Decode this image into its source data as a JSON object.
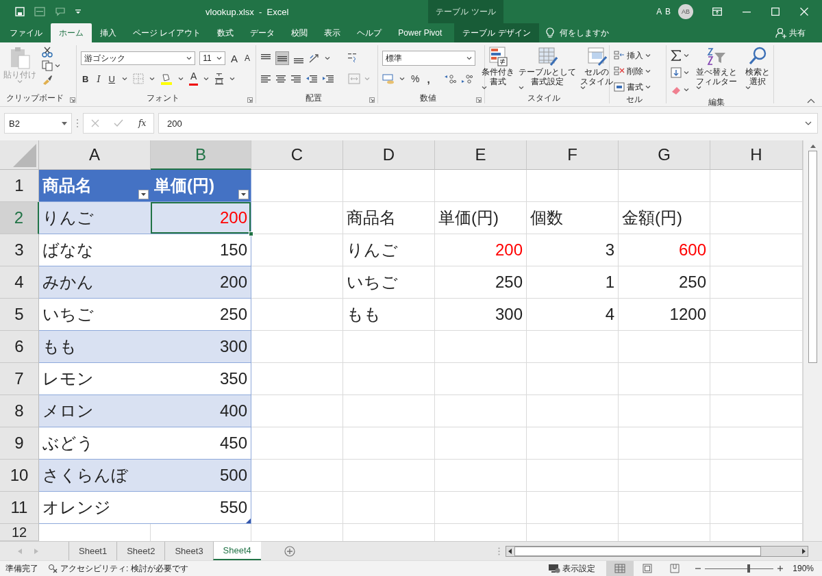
{
  "window": {
    "title": "vlookup.xlsx  -  Excel",
    "context_title": "テーブル ツール",
    "user": "A B",
    "avatar": "AB"
  },
  "tabs": [
    {
      "label": "ファイル",
      "kind": "file",
      "selected": false
    },
    {
      "label": "ホーム",
      "kind": "normal",
      "selected": true
    },
    {
      "label": "挿入",
      "kind": "normal",
      "selected": false
    },
    {
      "label": "ページ レイアウト",
      "kind": "normal",
      "selected": false
    },
    {
      "label": "数式",
      "kind": "normal",
      "selected": false
    },
    {
      "label": "データ",
      "kind": "normal",
      "selected": false
    },
    {
      "label": "校閲",
      "kind": "normal",
      "selected": false
    },
    {
      "label": "表示",
      "kind": "normal",
      "selected": false
    },
    {
      "label": "ヘルプ",
      "kind": "normal",
      "selected": false
    },
    {
      "label": "Power Pivot",
      "kind": "normal",
      "selected": false
    },
    {
      "label": "テーブル デザイン",
      "kind": "contextual",
      "selected": false
    }
  ],
  "tell_me": "何をしますか",
  "share": "共有",
  "ribbon": {
    "clipboard": {
      "label": "クリップボード",
      "paste": "貼り付け"
    },
    "font": {
      "label": "フォント",
      "font_name": "游ゴシック",
      "font_size": "11",
      "grow": "A",
      "shrink": "A",
      "bold": "B",
      "italic": "I",
      "underline": "U",
      "font_color": "A"
    },
    "alignment": {
      "label": "配置"
    },
    "number": {
      "label": "数値",
      "format": "標準",
      "percent": "%",
      "comma": ","
    },
    "styles": {
      "label": "スタイル",
      "buttons": [
        {
          "lines": [
            "条件付き",
            "書式"
          ]
        },
        {
          "lines": [
            "テーブルとして",
            "書式設定"
          ]
        },
        {
          "lines": [
            "セルの",
            "スタイル"
          ]
        }
      ]
    },
    "cells": {
      "label": "セル",
      "buttons": [
        "挿入",
        "削除",
        "書式"
      ]
    },
    "editing": {
      "label": "編集",
      "sort": [
        "並べ替えと",
        "フィルター"
      ],
      "find": [
        "検索と",
        "選択"
      ]
    }
  },
  "formula_bar": {
    "name_box": "B2",
    "fx": "fx",
    "formula": "200"
  },
  "grid": {
    "columns": [
      {
        "label": "A",
        "selected": false
      },
      {
        "label": "B",
        "selected": true
      },
      {
        "label": "C",
        "selected": false
      },
      {
        "label": "D",
        "selected": false
      },
      {
        "label": "E",
        "selected": false
      },
      {
        "label": "F",
        "selected": false
      },
      {
        "label": "G",
        "selected": false
      },
      {
        "label": "H",
        "selected": false
      }
    ],
    "rows": [
      {
        "number": "1",
        "selected": false,
        "cells": [
          {
            "kind": "header",
            "text": "商品名",
            "selected": false
          },
          {
            "kind": "header",
            "text": "単価(円)",
            "selected": false
          },
          {
            "kind": "empty",
            "selected": false
          },
          {
            "kind": "empty",
            "selected": false
          },
          {
            "kind": "empty",
            "selected": false
          },
          {
            "kind": "empty",
            "selected": false
          },
          {
            "kind": "empty",
            "selected": false
          },
          {
            "kind": "empty",
            "selected": false
          }
        ]
      },
      {
        "number": "2",
        "selected": true,
        "cells": [
          {
            "kind": "band_text",
            "text": "りんご",
            "selected": false
          },
          {
            "kind": "band_number",
            "text": "200",
            "color": "#ff0000",
            "selected": true
          },
          {
            "kind": "empty",
            "selected": false
          },
          {
            "kind": "plain_text",
            "text": "商品名",
            "selected": false
          },
          {
            "kind": "plain_text",
            "text": "単価(円)",
            "selected": false
          },
          {
            "kind": "plain_text",
            "text": "個数",
            "selected": false
          },
          {
            "kind": "plain_text",
            "text": "金額(円)",
            "selected": false
          },
          {
            "kind": "empty",
            "selected": false
          }
        ]
      },
      {
        "number": "3",
        "selected": false,
        "cells": [
          {
            "kind": "row_text",
            "text": "ばなな",
            "selected": false
          },
          {
            "kind": "row_number",
            "text": "150",
            "selected": false
          },
          {
            "kind": "empty",
            "selected": false
          },
          {
            "kind": "plain_text",
            "text": "りんご",
            "selected": false
          },
          {
            "kind": "plain_number",
            "text": "200",
            "color": "#ff0000",
            "selected": false
          },
          {
            "kind": "plain_number",
            "text": "3",
            "selected": false
          },
          {
            "kind": "plain_number",
            "text": "600",
            "color": "#ff0000",
            "selected": false
          },
          {
            "kind": "empty",
            "selected": false
          }
        ]
      },
      {
        "number": "4",
        "selected": false,
        "cells": [
          {
            "kind": "band_text",
            "text": "みかん",
            "selected": false
          },
          {
            "kind": "band_number",
            "text": "200",
            "selected": false
          },
          {
            "kind": "empty",
            "selected": false
          },
          {
            "kind": "plain_text",
            "text": "いちご",
            "selected": false
          },
          {
            "kind": "plain_number",
            "text": "250",
            "selected": false
          },
          {
            "kind": "plain_number",
            "text": "1",
            "selected": false
          },
          {
            "kind": "plain_number",
            "text": "250",
            "selected": false
          },
          {
            "kind": "empty",
            "selected": false
          }
        ]
      },
      {
        "number": "5",
        "selected": false,
        "cells": [
          {
            "kind": "row_text",
            "text": "いちご",
            "selected": false
          },
          {
            "kind": "row_number",
            "text": "250",
            "selected": false
          },
          {
            "kind": "empty",
            "selected": false
          },
          {
            "kind": "plain_text",
            "text": "もも",
            "selected": false
          },
          {
            "kind": "plain_number",
            "text": "300",
            "selected": false
          },
          {
            "kind": "plain_number",
            "text": "4",
            "selected": false
          },
          {
            "kind": "plain_number",
            "text": "1200",
            "selected": false
          },
          {
            "kind": "empty",
            "selected": false
          }
        ]
      },
      {
        "number": "6",
        "selected": false,
        "cells": [
          {
            "kind": "band_text",
            "text": "もも",
            "selected": false
          },
          {
            "kind": "band_number",
            "text": "300",
            "selected": false
          },
          {
            "kind": "empty",
            "selected": false
          },
          {
            "kind": "empty",
            "selected": false
          },
          {
            "kind": "empty",
            "selected": false
          },
          {
            "kind": "empty",
            "selected": false
          },
          {
            "kind": "empty",
            "selected": false
          },
          {
            "kind": "empty",
            "selected": false
          }
        ]
      },
      {
        "number": "7",
        "selected": false,
        "cells": [
          {
            "kind": "row_text",
            "text": "レモン",
            "selected": false
          },
          {
            "kind": "row_number",
            "text": "350",
            "selected": false
          },
          {
            "kind": "empty",
            "selected": false
          },
          {
            "kind": "empty",
            "selected": false
          },
          {
            "kind": "empty",
            "selected": false
          },
          {
            "kind": "empty",
            "selected": false
          },
          {
            "kind": "empty",
            "selected": false
          },
          {
            "kind": "empty",
            "selected": false
          }
        ]
      },
      {
        "number": "8",
        "selected": false,
        "cells": [
          {
            "kind": "band_text",
            "text": "メロン",
            "selected": false
          },
          {
            "kind": "band_number",
            "text": "400",
            "selected": false
          },
          {
            "kind": "empty",
            "selected": false
          },
          {
            "kind": "empty",
            "selected": false
          },
          {
            "kind": "empty",
            "selected": false
          },
          {
            "kind": "empty",
            "selected": false
          },
          {
            "kind": "empty",
            "selected": false
          },
          {
            "kind": "empty",
            "selected": false
          }
        ]
      },
      {
        "number": "9",
        "selected": false,
        "cells": [
          {
            "kind": "row_text",
            "text": "ぶどう",
            "selected": false
          },
          {
            "kind": "row_number",
            "text": "450",
            "selected": false
          },
          {
            "kind": "empty",
            "selected": false
          },
          {
            "kind": "empty",
            "selected": false
          },
          {
            "kind": "empty",
            "selected": false
          },
          {
            "kind": "empty",
            "selected": false
          },
          {
            "kind": "empty",
            "selected": false
          },
          {
            "kind": "empty",
            "selected": false
          }
        ]
      },
      {
        "number": "10",
        "selected": false,
        "cells": [
          {
            "kind": "band_text",
            "text": "さくらんぼ",
            "selected": false
          },
          {
            "kind": "band_number",
            "text": "500",
            "selected": false
          },
          {
            "kind": "empty",
            "selected": false
          },
          {
            "kind": "empty",
            "selected": false
          },
          {
            "kind": "empty",
            "selected": false
          },
          {
            "kind": "empty",
            "selected": false
          },
          {
            "kind": "empty",
            "selected": false
          },
          {
            "kind": "empty",
            "selected": false
          }
        ]
      },
      {
        "number": "11",
        "selected": false,
        "cells": [
          {
            "kind": "row_text",
            "text": "オレンジ",
            "selected": false
          },
          {
            "kind": "row_number",
            "text": "550",
            "selected": false
          },
          {
            "kind": "empty",
            "selected": false
          },
          {
            "kind": "empty",
            "selected": false
          },
          {
            "kind": "empty",
            "selected": false
          },
          {
            "kind": "empty",
            "selected": false
          },
          {
            "kind": "empty",
            "selected": false
          },
          {
            "kind": "empty",
            "selected": false
          }
        ]
      },
      {
        "number": "12",
        "selected": false,
        "cells": [
          {
            "kind": "empty",
            "selected": false
          },
          {
            "kind": "empty",
            "selected": false
          },
          {
            "kind": "empty",
            "selected": false
          },
          {
            "kind": "empty",
            "selected": false
          },
          {
            "kind": "empty",
            "selected": false
          },
          {
            "kind": "empty",
            "selected": false
          },
          {
            "kind": "empty",
            "selected": false
          },
          {
            "kind": "empty",
            "selected": false
          }
        ]
      }
    ]
  },
  "sheets": [
    {
      "label": "Sheet1",
      "selected": false
    },
    {
      "label": "Sheet2",
      "selected": false
    },
    {
      "label": "Sheet3",
      "selected": false
    },
    {
      "label": "Sheet4",
      "selected": true
    }
  ],
  "status_bar": {
    "ready": "準備完了",
    "accessibility": "アクセシビリティ: 検討が必要です",
    "display_settings": "表示設定",
    "views": [
      {
        "kind": "normal",
        "selected": true
      },
      {
        "kind": "page_layout",
        "selected": false
      },
      {
        "kind": "page_break",
        "selected": false
      }
    ],
    "zoom": {
      "level": 0.64,
      "reading": "190%"
    }
  }
}
